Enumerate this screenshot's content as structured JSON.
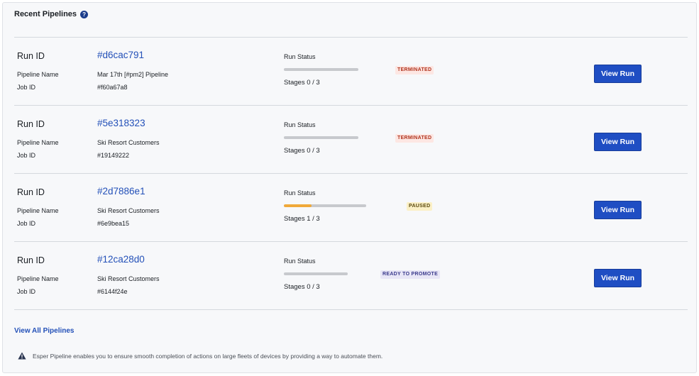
{
  "header": {
    "title": "Recent Pipelines",
    "help_icon": "help-circle-icon"
  },
  "labels": {
    "run_id": "Run ID",
    "pipeline_name": "Pipeline Name",
    "job_id": "Job ID",
    "run_status": "Run Status",
    "view_run": "View Run"
  },
  "colors": {
    "primary": "#1f4ec3",
    "link": "#2350b8",
    "progress_fill": "#f0a93a",
    "progress_track": "#c7c9cd"
  },
  "pipelines": [
    {
      "run_id": "#d6cac791",
      "pipeline_name": "Mar 17th [#pm2] Pipeline",
      "job_id": "#f60a67a8",
      "status": "TERMINATED",
      "status_type": "terminated",
      "stages_text": "Stages 0 / 3",
      "progress": 0
    },
    {
      "run_id": "#5e318323",
      "pipeline_name": "Ski Resort Customers",
      "job_id": "#19149222",
      "status": "TERMINATED",
      "status_type": "terminated",
      "stages_text": "Stages 0 / 3",
      "progress": 0
    },
    {
      "run_id": "#2d7886e1",
      "pipeline_name": "Ski Resort Customers",
      "job_id": "#6e9bea15",
      "status": "PAUSED",
      "status_type": "paused",
      "stages_text": "Stages 1 / 3",
      "progress": 0.333
    },
    {
      "run_id": "#12ca28d0",
      "pipeline_name": "Ski Resort Customers",
      "job_id": "#6144f24e",
      "status": "READY TO PROMOTE",
      "status_type": "ready",
      "stages_text": "Stages 0 / 3",
      "progress": 0
    }
  ],
  "footer": {
    "view_all": "View All Pipelines",
    "note": "Esper Pipeline enables you to ensure smooth completion of actions on large fleets of devices by providing a way to automate them.",
    "note_icon": "warning-triangle-icon"
  }
}
